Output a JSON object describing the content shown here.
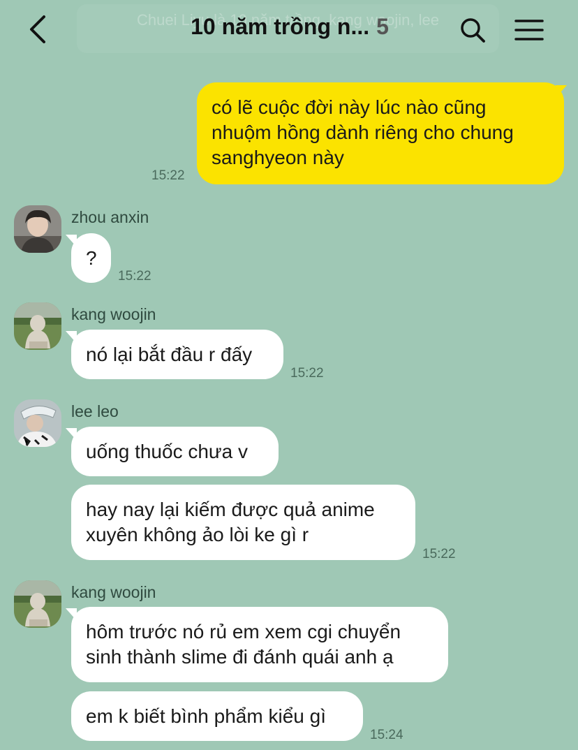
{
  "header": {
    "title": "10 năm trồng n...",
    "member_count": "5",
    "ghost_line1": "Chuei Liyu là 10 năm trồng. kang woojin, lee",
    "ghost_line2": "..."
  },
  "messages": [
    {
      "type": "outgoing",
      "text": "có lẽ cuộc đời này lúc nào cũng\nnhuộm hồng dành riêng cho chung\nsanghyeon này",
      "time": "15:22"
    },
    {
      "type": "incoming",
      "sender": "zhou anxin",
      "text": "?",
      "time": "15:22"
    },
    {
      "type": "incoming",
      "sender": "kang woojin",
      "text": "nó lại bắt đầu r đấy",
      "time": "15:22"
    },
    {
      "type": "incoming",
      "sender": "lee leo",
      "text": "uống thuốc chưa v"
    },
    {
      "type": "incoming-continued",
      "text": "hay nay lại kiếm được quả anime\nxuyên không ảo lòi ke gì r",
      "time": "15:22"
    },
    {
      "type": "incoming",
      "sender": "kang woojin",
      "text": "hôm trước nó rủ em xem cgi chuyển\nsinh thành slime đi đánh quái anh ạ"
    },
    {
      "type": "incoming-continued",
      "text": "em k biết bình phẩm kiểu gì",
      "time": "15:24"
    }
  ],
  "colors": {
    "background": "#9fc8b5",
    "outgoing_bubble": "#fbe300",
    "incoming_bubble": "#ffffff"
  },
  "icons": {
    "back": "back-chevron-icon",
    "search": "search-icon",
    "menu": "hamburger-menu-icon"
  }
}
